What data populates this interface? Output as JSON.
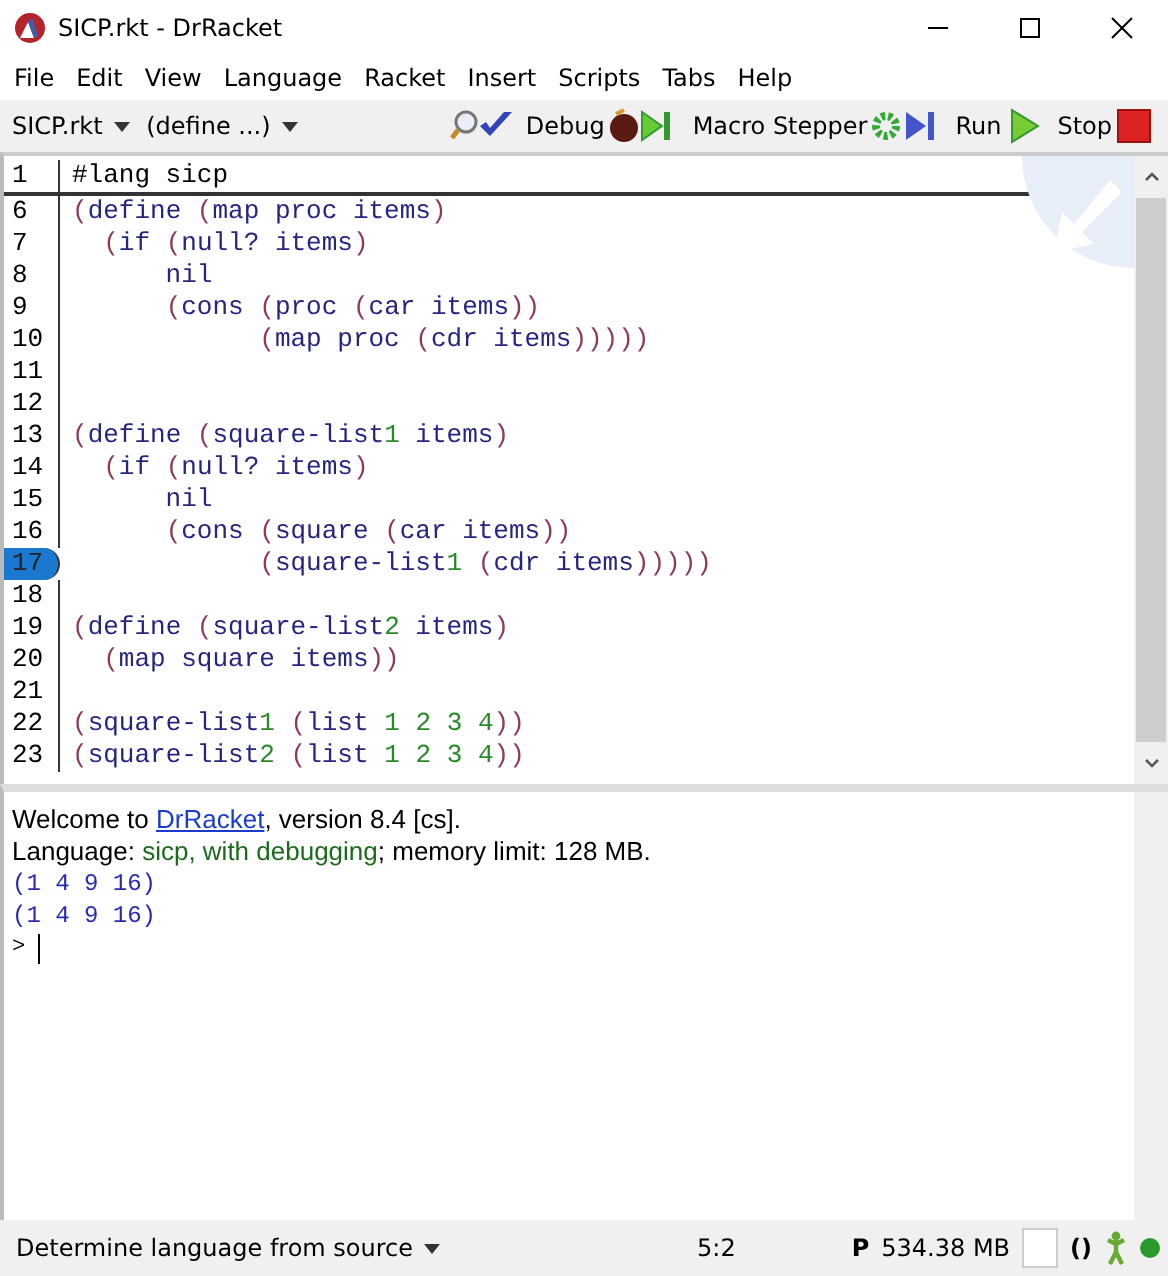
{
  "window": {
    "title": "SICP.rkt - DrRacket"
  },
  "menu": [
    "File",
    "Edit",
    "View",
    "Language",
    "Racket",
    "Insert",
    "Scripts",
    "Tabs",
    "Help"
  ],
  "toolbar": {
    "file": "SICP.rkt",
    "definitions": "(define ...)",
    "buttons": [
      {
        "label": "Debug",
        "kind": "debug"
      },
      {
        "label": "Macro Stepper",
        "kind": "macro"
      },
      {
        "label": "Run",
        "kind": "run"
      },
      {
        "label": "Stop",
        "kind": "stop"
      }
    ]
  },
  "editor": {
    "header": {
      "number": "1",
      "code": "#lang sicp"
    },
    "lines": [
      {
        "number": "6",
        "code": "(define (map proc items)",
        "breakpoint": false
      },
      {
        "number": "7",
        "code": "  (if (null? items)",
        "breakpoint": false
      },
      {
        "number": "8",
        "code": "      nil",
        "breakpoint": false
      },
      {
        "number": "9",
        "code": "      (cons (proc (car items))",
        "breakpoint": false
      },
      {
        "number": "10",
        "code": "            (map proc (cdr items)))))",
        "breakpoint": false
      },
      {
        "number": "11",
        "breakpoint": false
      },
      {
        "number": "12",
        "breakpoint": false
      },
      {
        "number": "13",
        "code": "(define (square-list1 items)",
        "breakpoint": false
      },
      {
        "number": "14",
        "code": "  (if (null? items)",
        "breakpoint": false
      },
      {
        "number": "15",
        "code": "      nil",
        "breakpoint": false
      },
      {
        "number": "16",
        "code": "      (cons (square (car items))",
        "breakpoint": false
      },
      {
        "number": "17",
        "code": "            (square-list1 (cdr items)))))",
        "breakpoint": true
      },
      {
        "number": "18",
        "breakpoint": false
      },
      {
        "number": "19",
        "code": "(define (square-list2 items)",
        "breakpoint": false
      },
      {
        "number": "20",
        "code": "  (map square items))",
        "breakpoint": false
      },
      {
        "number": "21",
        "breakpoint": false
      },
      {
        "number": "22",
        "code": "(square-list1 (list 1 2 3 4))",
        "breakpoint": false
      },
      {
        "number": "23",
        "code": "(square-list2 (list 1 2 3 4))",
        "breakpoint": false
      }
    ]
  },
  "interactions": {
    "welcome_before": "Welcome to ",
    "welcome_link": "DrRacket",
    "welcome_after": ", version 8.4 [cs].",
    "language_label": "Language: ",
    "language": "sicp, with debugging",
    "memory": "; memory limit: 128 MB.",
    "outputs": [
      "(1 4 9 16)",
      "(1 4 9 16)"
    ],
    "prompt": ">"
  },
  "status_bar": {
    "language": "Determine language from source",
    "position": "5:2",
    "mode": "P",
    "memory": "534.38 MB",
    "parens": "()"
  }
}
